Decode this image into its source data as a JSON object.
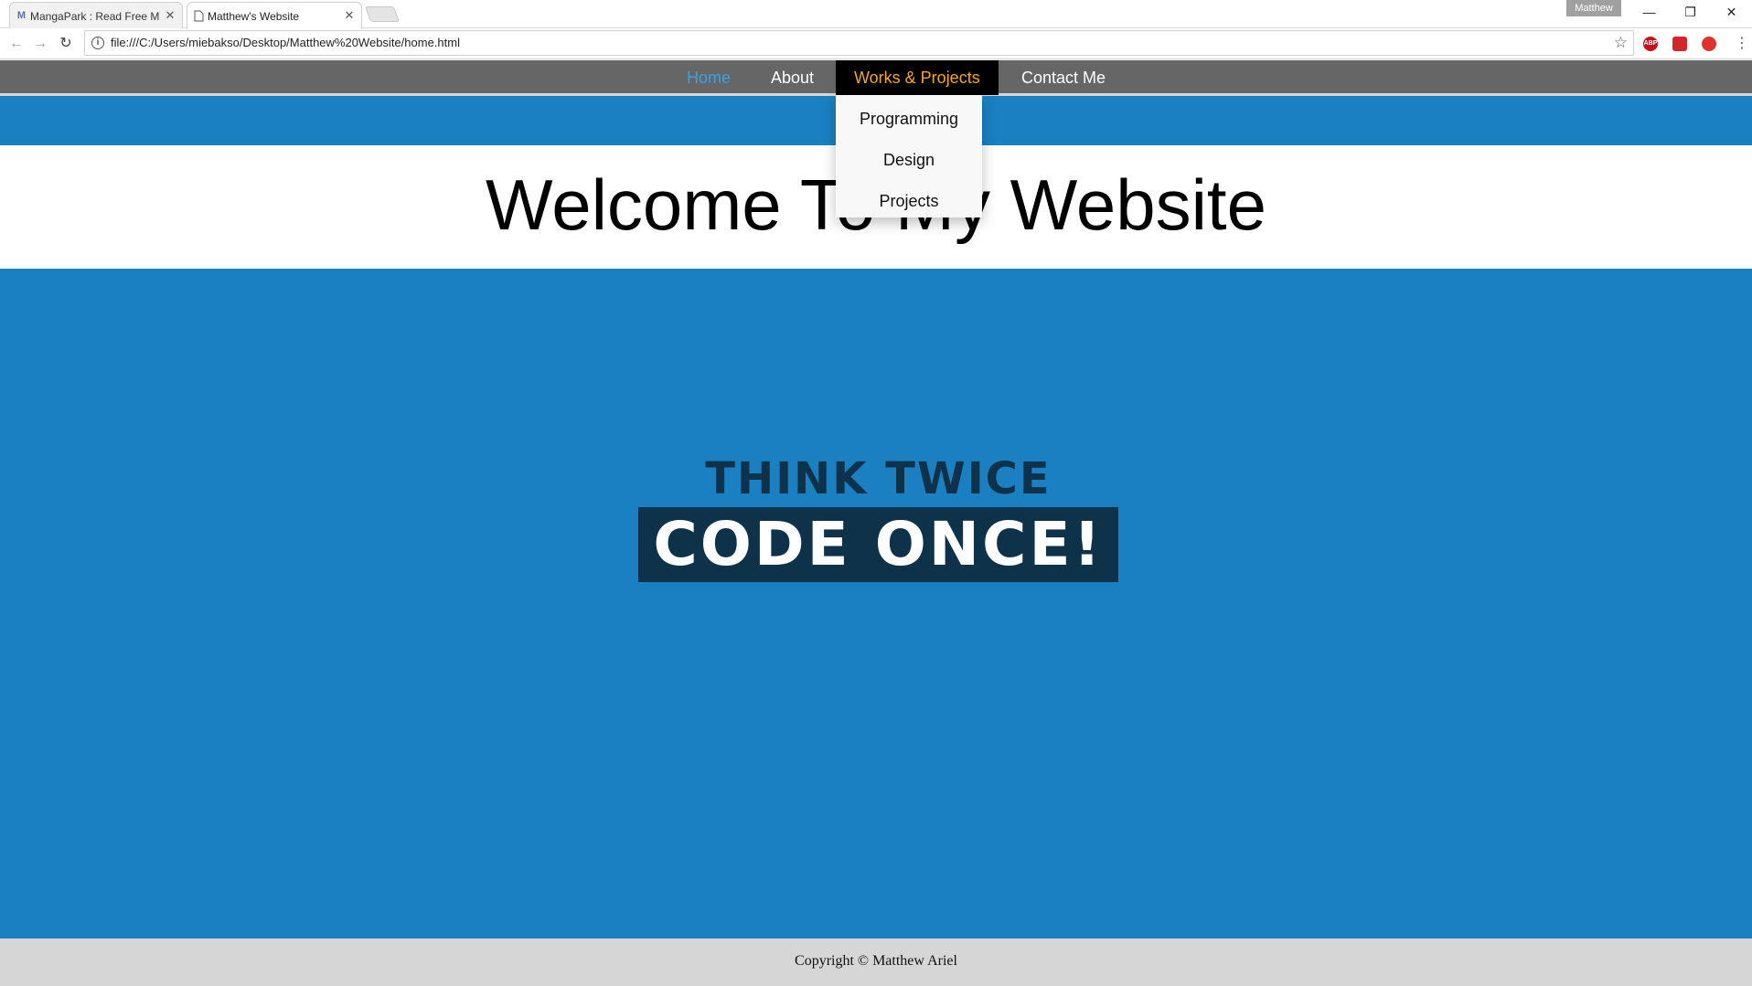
{
  "browser": {
    "tabs": [
      {
        "label": "MangaPark : Read Free M",
        "favicon": "M"
      },
      {
        "label": "Matthew's Website",
        "favicon": "page"
      }
    ],
    "profile": "Matthew",
    "url": "file:///C:/Users/miebakso/Desktop/Matthew%20Website/home.html",
    "extensions": [
      {
        "name": "adblock-plus-icon",
        "text": "ABP",
        "color": "#c4131c"
      },
      {
        "name": "pdf-extension-icon",
        "text": "",
        "color": "#d3262b"
      },
      {
        "name": "red-extension-icon",
        "text": "",
        "color": "#e0322c"
      }
    ]
  },
  "site": {
    "nav": {
      "home": "Home",
      "about": "About",
      "works": "Works & Projects",
      "contact": "Contact Me"
    },
    "dropdown": [
      "Programming",
      "Design",
      "Projects"
    ],
    "hero_title": "Welcome To My Website",
    "slogan": {
      "top": "THINK TWICE",
      "bottom": "CODE ONCE!"
    },
    "footer": "Copyright © Matthew Ariel"
  },
  "colors": {
    "nav_bg": "#666666",
    "home_link": "#36a3e6",
    "works_link": "#f5a623",
    "page_blue": "#1a80c2",
    "slogan_dark": "#0d3249",
    "footer_bg": "#d6d6d6"
  }
}
